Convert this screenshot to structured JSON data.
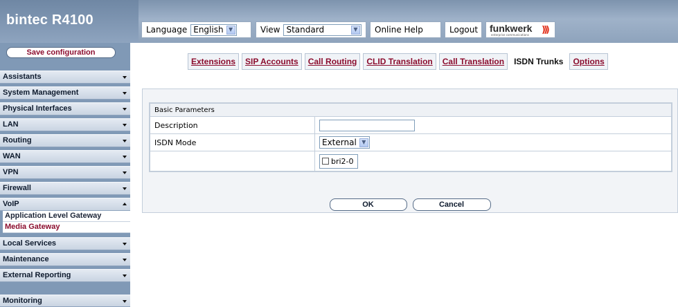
{
  "app": {
    "brand": "bintec R4100"
  },
  "toolbar": {
    "language_label": "Language",
    "language_value": "English",
    "view_label": "View",
    "view_value": "Standard",
    "online_help": "Online Help",
    "logout": "Logout",
    "logo_name": "funkwerk",
    "logo_sub": "enterprise communications"
  },
  "sidebar": {
    "save": "Save configuration",
    "items": [
      "Assistants",
      "System Management",
      "Physical Interfaces",
      "LAN",
      "Routing",
      "WAN",
      "VPN",
      "Firewall",
      "VoIP",
      "Local Services",
      "Maintenance",
      "External Reporting",
      "Monitoring"
    ],
    "voip_sub": [
      "Application Level Gateway",
      "Media Gateway"
    ]
  },
  "tabs": [
    "Extensions",
    "SIP Accounts",
    "Call Routing",
    "CLID Translation",
    "Call Translation",
    "ISDN Trunks",
    "Options"
  ],
  "form": {
    "section_title": "Basic Parameters",
    "description_label": "Description",
    "description_value": "",
    "isdn_mode_label": "ISDN Mode",
    "isdn_mode_value": "External",
    "interface_option": "bri2-0",
    "interface_checked": false
  },
  "buttons": {
    "ok": "OK",
    "cancel": "Cancel"
  },
  "colors": {
    "accent": "#8b0d2e",
    "header_bg": "#8ea3bc",
    "sidebar_bg": "#8099b6"
  }
}
